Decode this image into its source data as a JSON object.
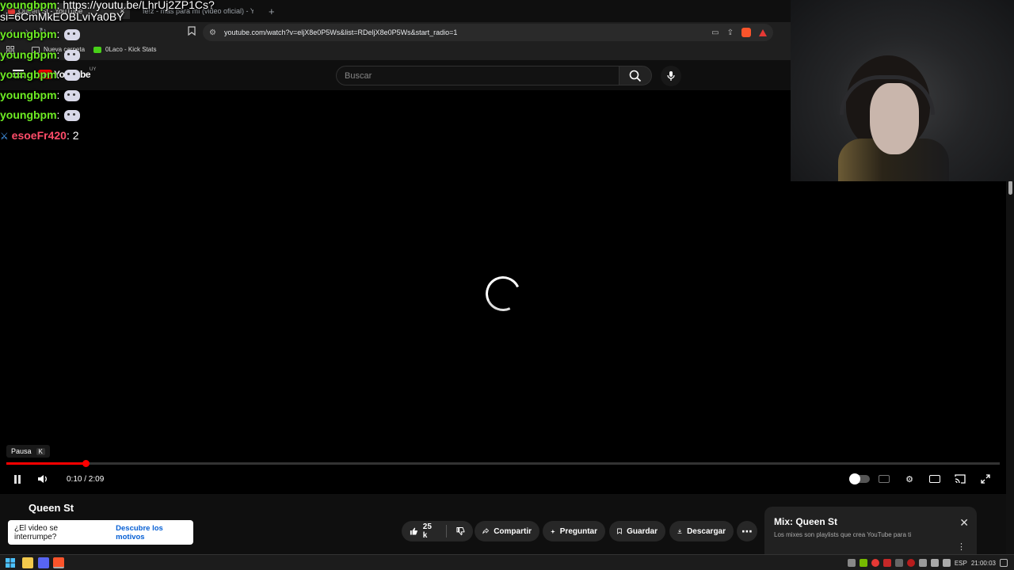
{
  "browser": {
    "tabs": [
      {
        "title": "Queen St - YouTube"
      },
      {
        "title": "fe!z - más para mí (video oficial) - Yo"
      }
    ],
    "new_tab": "+",
    "url": "youtube.com/watch?v=eljX8e0P5Ws&list=RDeljX8e0P5Ws&start_radio=1",
    "bookmarks": [
      {
        "label": "Nueva carpeta"
      },
      {
        "label": "0Laco - Kick Stats"
      }
    ]
  },
  "chat": {
    "line0": "youngbpm: https://youtu.be/LhrUj2ZP1Cs?",
    "line0_user": "youngbpm",
    "line0_msg": ": https://youtu.be/LhrUj2ZP1Cs?",
    "line1": "si=6CmMkEOBLviYa0BY",
    "messages": [
      {
        "user": "youngbpm",
        "sep": ":"
      },
      {
        "user": "youngbpm",
        "sep": ":"
      },
      {
        "user": "youngbpm",
        "sep": ":"
      },
      {
        "user": "youngbpm",
        "sep": ":"
      },
      {
        "user": "youngbpm",
        "sep": ":"
      }
    ],
    "last": {
      "user": "esoeFr420",
      "msg": ": 2"
    }
  },
  "youtube": {
    "logo": "YouTube",
    "country": "UY",
    "search_placeholder": "Buscar"
  },
  "player": {
    "tooltip_label": "Pausa",
    "tooltip_key": "K",
    "time": "0:10 / 2:09",
    "progress": 0.08,
    "state": "loading"
  },
  "video": {
    "title": "Queen St",
    "interrupt_text": "¿El video se interrumpe?",
    "interrupt_link": "Descubre los motivos",
    "likes": "25 k",
    "share": "Compartir",
    "ask": "Preguntar",
    "save": "Guardar",
    "download": "Descargar"
  },
  "mix": {
    "title": "Mix: Queen St",
    "subtitle": "Los mixes son playlists que crea YouTube para ti"
  },
  "taskbar": {
    "lang": "ESP",
    "clock": "21:00:03"
  },
  "colors": {
    "yt_red": "#ff0000",
    "chat_user": "#6eec24",
    "chat_user2": "#ff4d6a",
    "link_blue": "#065fd4"
  }
}
